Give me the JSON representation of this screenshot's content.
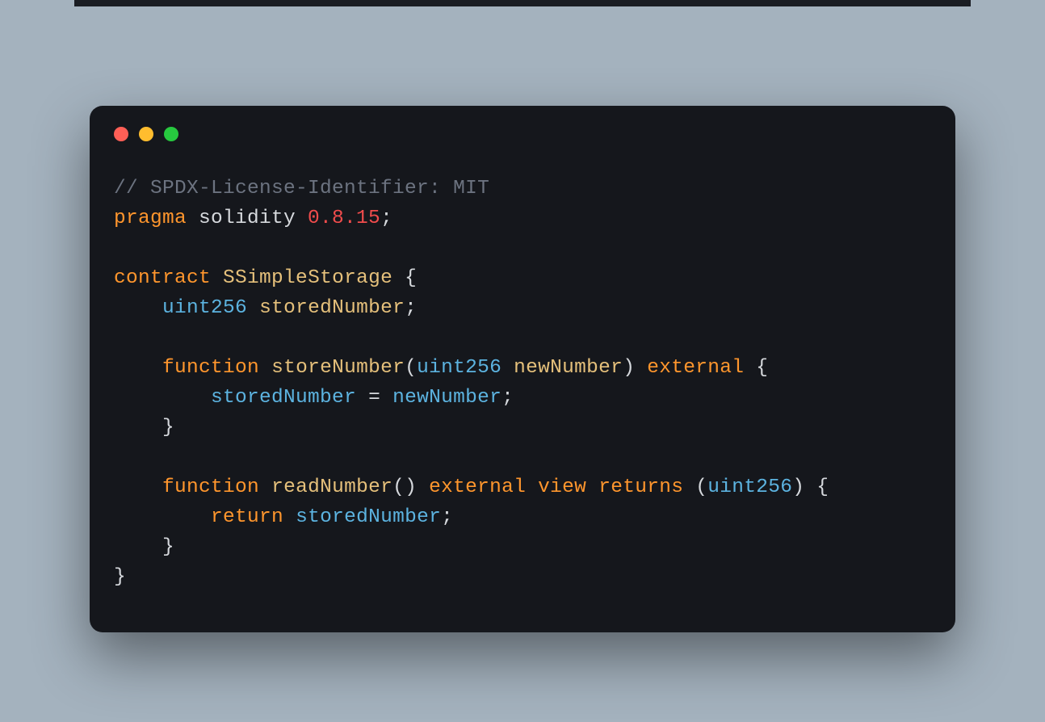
{
  "code": {
    "line1_comment": "// SPDX-License-Identifier: MIT",
    "line2_pragma": "pragma",
    "line2_solidity": " solidity ",
    "line2_version": "0.8.15",
    "line2_semi": ";",
    "line4_contract": "contract",
    "line4_space": " ",
    "line4_name": "SSimpleStorage",
    "line4_brace": " {",
    "line5_indent": "    ",
    "line5_type": "uint256",
    "line5_space": " ",
    "line5_var": "storedNumber",
    "line5_semi": ";",
    "line7_indent": "    ",
    "line7_function": "function",
    "line7_space1": " ",
    "line7_name": "storeNumber",
    "line7_paren_open": "(",
    "line7_paramtype": "uint256",
    "line7_space2": " ",
    "line7_paramname": "newNumber",
    "line7_paren_close": ")",
    "line7_space3": " ",
    "line7_external": "external",
    "line7_brace": " {",
    "line8_indent": "        ",
    "line8_var": "storedNumber",
    "line8_eq": " = ",
    "line8_val": "newNumber",
    "line8_semi": ";",
    "line9_indent": "    ",
    "line9_brace": "}",
    "line11_indent": "    ",
    "line11_function": "function",
    "line11_space1": " ",
    "line11_name": "readNumber",
    "line11_parens": "()",
    "line11_space2": " ",
    "line11_external": "external",
    "line11_space3": " ",
    "line11_view": "view",
    "line11_space4": " ",
    "line11_returns": "returns",
    "line11_space5": " (",
    "line11_rettype": "uint256",
    "line11_paren_close": ")",
    "line11_brace": " {",
    "line12_indent": "        ",
    "line12_return": "return",
    "line12_space": " ",
    "line12_var": "storedNumber",
    "line12_semi": ";",
    "line13_indent": "    ",
    "line13_brace": "}",
    "line14_brace": "}"
  }
}
